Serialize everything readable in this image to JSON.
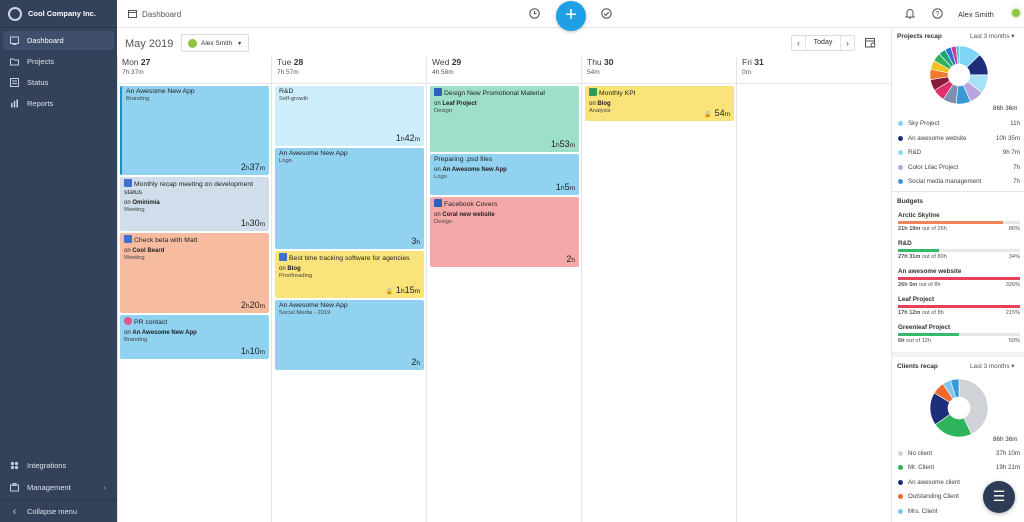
{
  "company": "Cool Company Inc.",
  "nav": {
    "items": [
      {
        "label": "Dashboard",
        "icon": "dashboard-icon"
      },
      {
        "label": "Projects",
        "icon": "folder-icon"
      },
      {
        "label": "Status",
        "icon": "status-icon"
      },
      {
        "label": "Reports",
        "icon": "reports-icon"
      }
    ],
    "integrations": "Integrations",
    "management": "Management",
    "collapse": "Collapse menu"
  },
  "topbar": {
    "page": "Dashboard",
    "user": "Alex Smith"
  },
  "calendar": {
    "month": "May 2019",
    "user_filter": "Alex Smith",
    "today": "Today",
    "days": [
      {
        "name": "Mon",
        "num": "27",
        "total": "7h 37m"
      },
      {
        "name": "Tue",
        "num": "28",
        "total": "7h 57m"
      },
      {
        "name": "Wed",
        "num": "29",
        "total": "4h 58m"
      },
      {
        "name": "Thu",
        "num": "30",
        "total": "54m"
      },
      {
        "name": "Fri",
        "num": "31",
        "total": "0m"
      }
    ],
    "events": {
      "mon": [
        {
          "title": "An Awesome New App",
          "sub": "Branding",
          "h": "2",
          "m": "37"
        },
        {
          "title": "Monthly recap meeting on development status",
          "proj": "Ominimia",
          "sub": "Meeting",
          "h": "1",
          "m": "30"
        },
        {
          "title": "Check beta with Matt",
          "proj": "Cool Beard",
          "sub": "Meeting",
          "h": "2",
          "m": "20"
        },
        {
          "title": "PR contact",
          "proj": "An Awesome New App",
          "sub": "Branding",
          "h": "1",
          "m": "10"
        }
      ],
      "tue": [
        {
          "title": "R&D",
          "sub": "Self-growth",
          "h": "1",
          "m": "42"
        },
        {
          "title": "An Awesome New App",
          "sub": "Logo",
          "h": "3",
          "m": ""
        },
        {
          "title": "Best time tracking software for agencies",
          "proj": "Blog",
          "sub": "Proofreading",
          "h": "1",
          "m": "15"
        },
        {
          "title": "An Awesome New App",
          "sub": "Social Media - 2019",
          "h": "2",
          "m": ""
        }
      ],
      "wed": [
        {
          "title": "Design New Promotional Material",
          "proj": "Leaf Project",
          "sub": "Design",
          "h": "1",
          "m": "53"
        },
        {
          "title": "Preparing .psd files",
          "proj": "An Awesome New App",
          "sub": "Logo",
          "h": "1",
          "m": "5"
        },
        {
          "title": "Facebook Covers",
          "proj": "Coral new website",
          "sub": "Design",
          "h": "2",
          "m": ""
        }
      ],
      "thu": [
        {
          "title": "Monthly KPI",
          "proj": "Blog",
          "sub": "Analysis",
          "h": "",
          "m": "54"
        }
      ]
    }
  },
  "on_word": "on",
  "h_unit": "h",
  "m_unit": "m",
  "projects_recap": {
    "title": "Projects recap",
    "range": "Last 3 months",
    "total": "86h 36m",
    "items": [
      {
        "name": "Sky Project",
        "value": "11h",
        "color": "#7fd3f7"
      },
      {
        "name": "An awesome website",
        "value": "10h 35m",
        "color": "#1d2f7a"
      },
      {
        "name": "R&D",
        "value": "9h 7m",
        "color": "#8fd8f5"
      },
      {
        "name": "Color Lilac Project",
        "value": "7h",
        "color": "#b7a5e0"
      },
      {
        "name": "Social media management",
        "value": "7h",
        "color": "#3a9ad9"
      }
    ],
    "slices": [
      11,
      10.58,
      9.12,
      7,
      7,
      6.5,
      6,
      5.5,
      5,
      4.5,
      4,
      3.5,
      3,
      2.5,
      1.4
    ],
    "slice_colors": [
      "#7fd3f7",
      "#1d2f7a",
      "#a5e2f7",
      "#b7a5e0",
      "#3a9ad9",
      "#7d8fb3",
      "#e0316e",
      "#8b1a3a",
      "#f07a2e",
      "#f5c21b",
      "#2fb45b",
      "#1fa67a",
      "#2f6fd0",
      "#c23fa0",
      "#3abbd6"
    ]
  },
  "budgets": {
    "title": "Budgets",
    "items": [
      {
        "name": "Arctic Skyline",
        "spent": "21h 19m",
        "total": "26h",
        "pct_label": "86%",
        "pct": 0.86,
        "color": "#f0845a"
      },
      {
        "name": "R&D",
        "spent": "27h 31m",
        "total": "80h",
        "pct_label": "34%",
        "pct": 0.34,
        "color": "#35b96a"
      },
      {
        "name": "An awesome website",
        "spent": "26h 5m",
        "total": "8h",
        "pct_label": "326%",
        "pct": 1.0,
        "color": "#e8405b"
      },
      {
        "name": "Leaf Project",
        "spent": "17h 12m",
        "total": "8h",
        "pct_label": "215%",
        "pct": 1.0,
        "color": "#e8405b"
      },
      {
        "name": "Greenleaf Project",
        "spent": "6h",
        "total": "12h",
        "pct_label": "50%",
        "pct": 0.5,
        "color": "#35b96a"
      }
    ],
    "out_of": "out of"
  },
  "clients_recap": {
    "title": "Clients recap",
    "range": "Last 3 months",
    "total": "86h 36m",
    "items": [
      {
        "name": "No client",
        "value": "37h 10m",
        "color": "#cfd2d6"
      },
      {
        "name": "Mr. Client",
        "value": "19h 21m",
        "color": "#2fb45b"
      },
      {
        "name": "An awesome client",
        "value": "",
        "color": "#1d2f7a"
      },
      {
        "name": "Outstanding Client",
        "value": "",
        "color": "#f06a2e"
      },
      {
        "name": "Mrs. Client",
        "value": "",
        "color": "#7fc7f2"
      }
    ],
    "slices": [
      37.17,
      19.35,
      16,
      6,
      4,
      4.1
    ],
    "slice_colors": [
      "#cfd2d6",
      "#2fb45b",
      "#1d2f7a",
      "#f06a2e",
      "#7fc7f2",
      "#3a9ad9"
    ]
  }
}
